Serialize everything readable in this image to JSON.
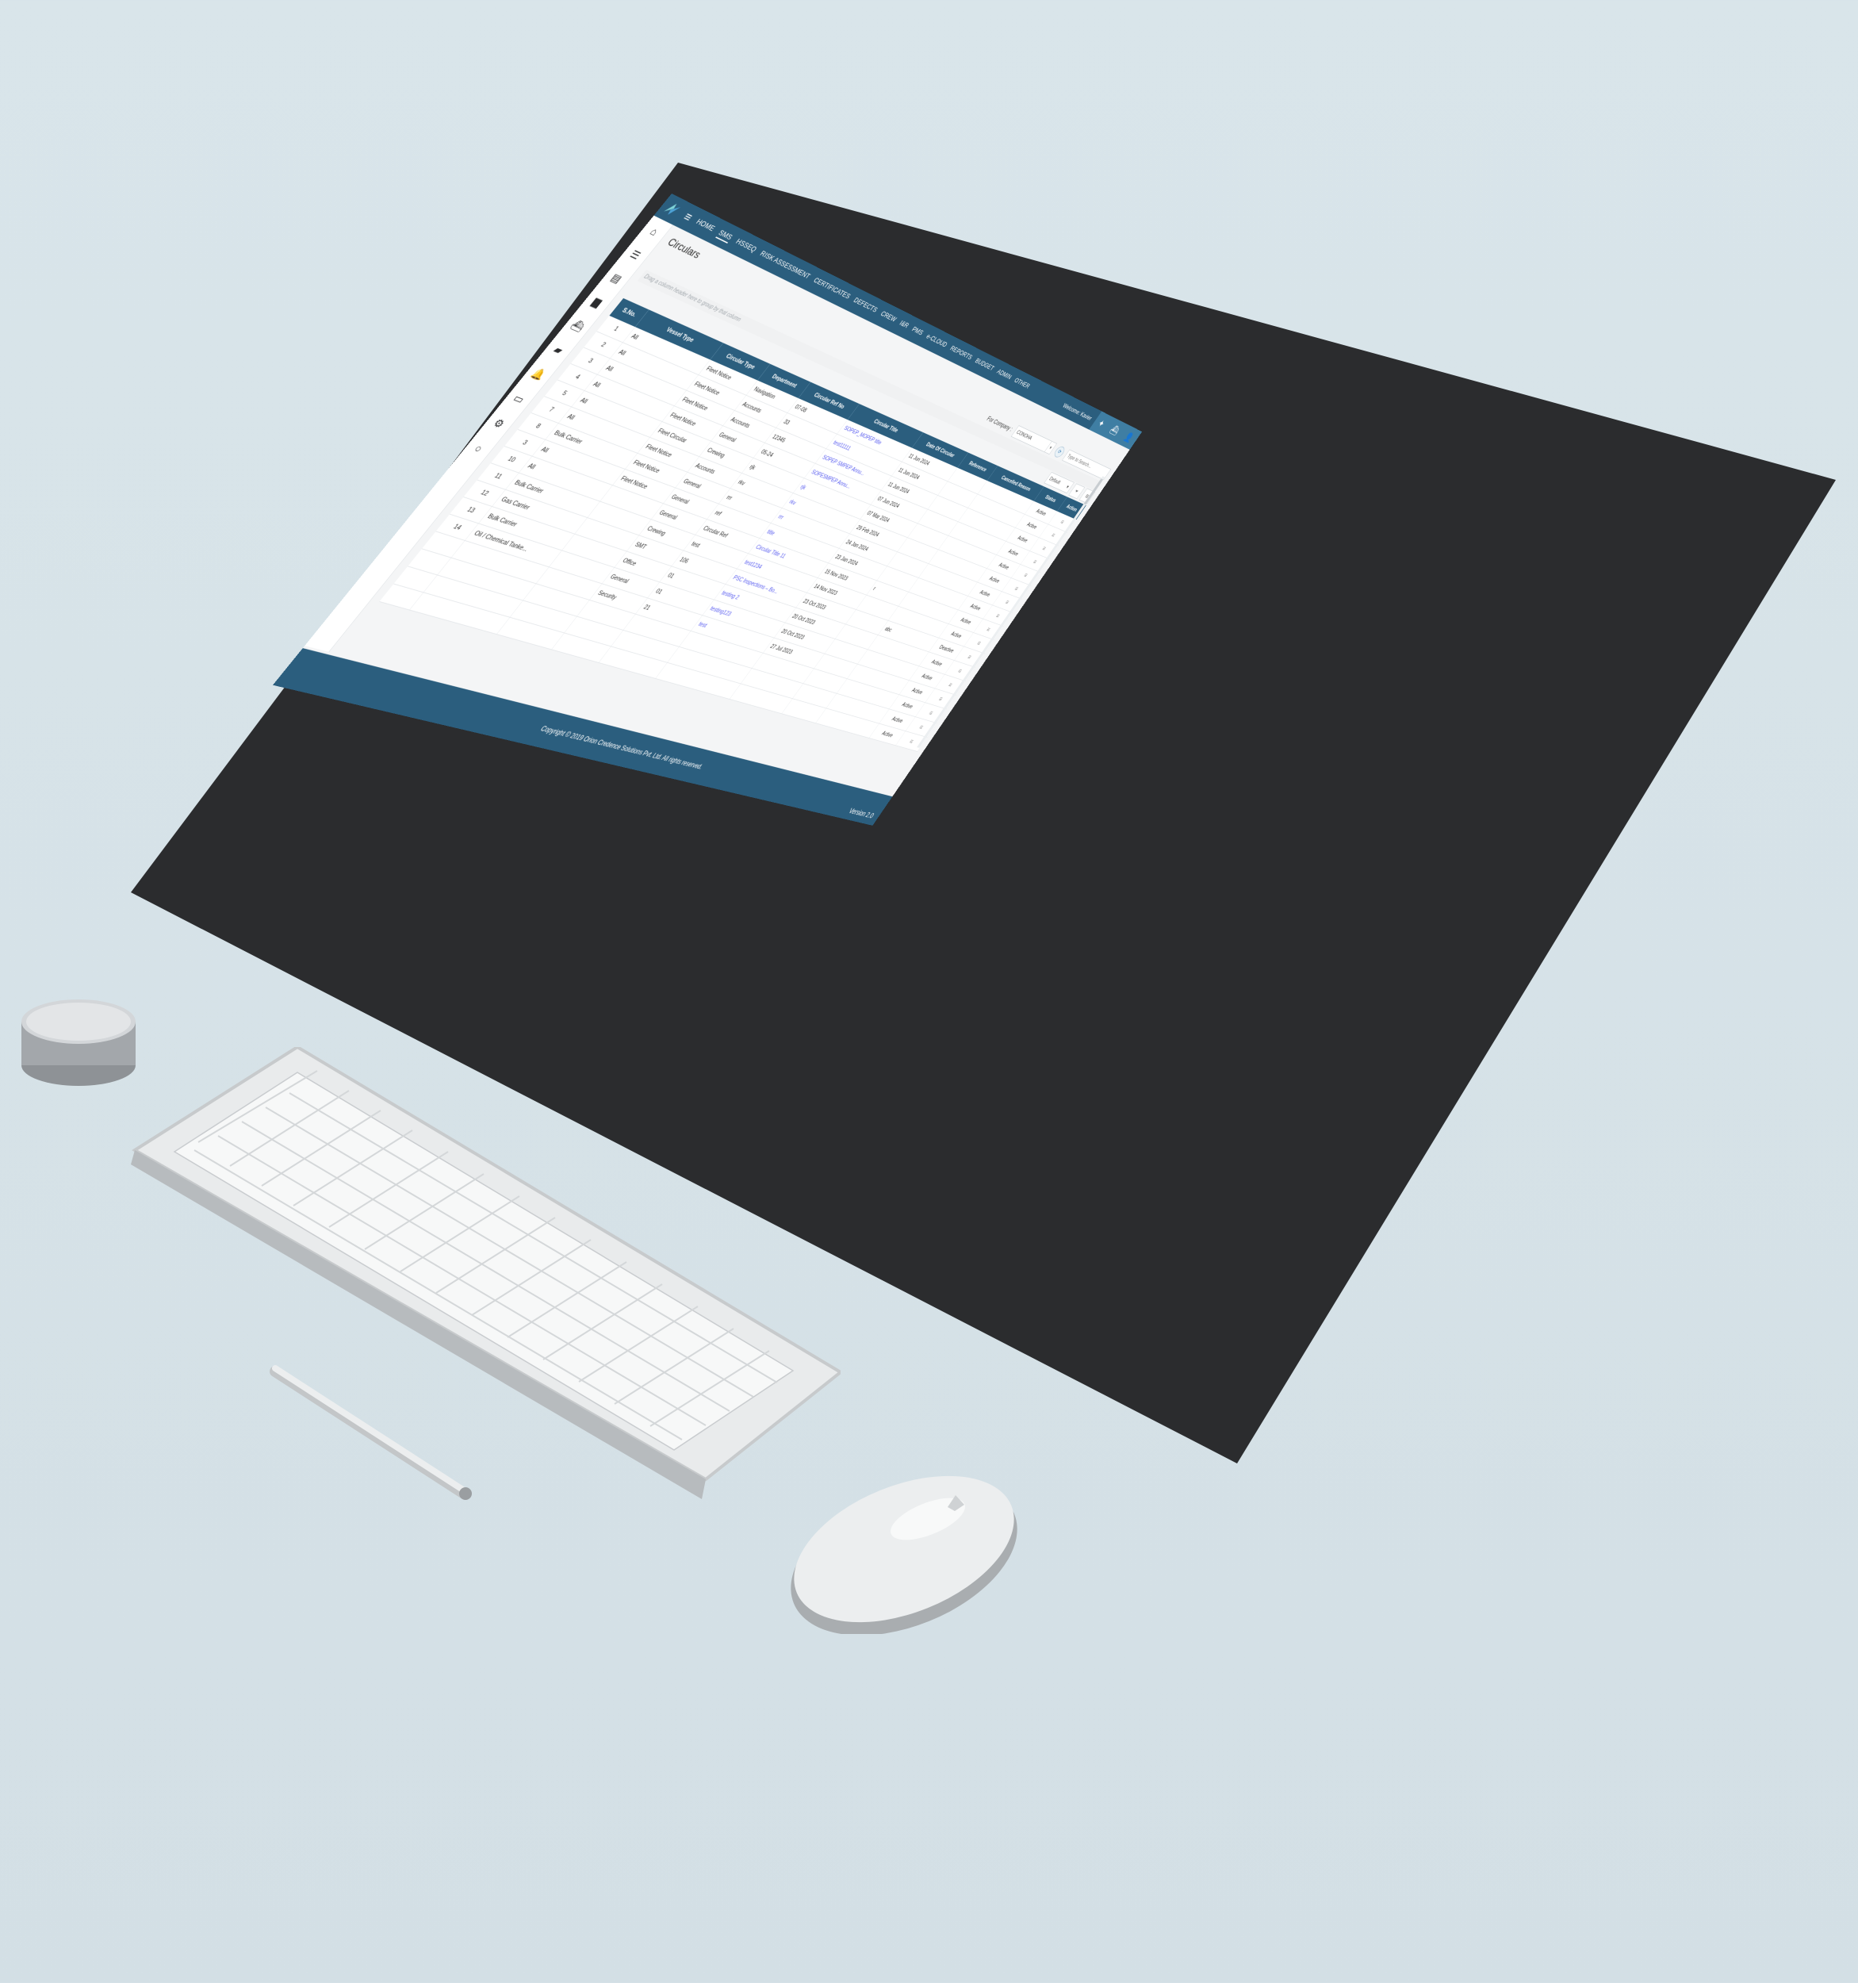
{
  "app": {
    "menu_icon": "hamburger-icon",
    "nav": [
      "HOME",
      "SMS",
      "HSSEQ",
      "RISK ASSESSMENT",
      "CERTIFICATES",
      "DEFECTS",
      "CREW",
      "I&R",
      "PMS",
      "e-CLOUD",
      "REPORTS",
      "BUDGET",
      "ADMIN",
      "OTHER"
    ],
    "active_nav": "SMS",
    "welcome": "Welcome: Kavier",
    "top_icons": [
      "logo-icon",
      "ship-icon",
      "user-icon"
    ]
  },
  "sidebar": [
    "home-icon",
    "list-icon",
    "document-icon",
    "folder-icon",
    "ship-icon",
    "folder-open-icon",
    "bell-icon",
    "file-icon",
    "settings-icon",
    "circle-icon"
  ],
  "page": {
    "title": "Circulars",
    "company_label": "For Company :",
    "company_value": "CONOHA",
    "search_placeholder": "Type to Search...",
    "group_hint": "Drag a column header here to group by that column",
    "view_select": "Default",
    "filter_icon": "filter-icon",
    "columns_icon": "columns-icon"
  },
  "table": {
    "columns": [
      "S.No.",
      "Vessel Type",
      "Circular Type",
      "Department",
      "Circular Ref No",
      "Circular Title",
      "Date Of Circular",
      "Reference",
      "Cancelled Reason",
      "Status",
      "Action"
    ],
    "rows": [
      [
        "1",
        "All",
        "Fleet Notice",
        "Navigation",
        "07-08",
        "SOPEP_MOPEP title",
        "11 Jun 2024",
        "",
        "",
        "Active"
      ],
      [
        "2",
        "All",
        "Fleet Notice",
        "Accounts",
        "33",
        "test11111",
        "11 Jun 2024",
        "",
        "",
        "Active"
      ],
      [
        "3",
        "All",
        "Fleet Notice",
        "Accounts",
        "12345",
        "SOPEP SMPEP Annu...",
        "11 Jun 2024",
        "",
        "",
        "Active"
      ],
      [
        "4",
        "All",
        "Fleet Notice",
        "General",
        "05-24",
        "SOPESMPEP Annu...",
        "07 Jun 2024",
        "",
        "",
        "Active"
      ],
      [
        "5",
        "All",
        "Fleet Circular",
        "Crewing",
        "rjk",
        "rjk",
        "07 Mar 2024",
        "",
        "",
        "Active"
      ],
      [
        "7",
        "All",
        "Fleet Notice",
        "Accounts",
        "rkv",
        "rkv",
        "29 Feb 2024",
        "",
        "",
        "Active"
      ],
      [
        "8",
        "Bulk Carrier",
        "Fleet Notice",
        "General",
        "rrr",
        "rrr",
        "24 Jan 2024",
        "",
        "",
        "Active"
      ],
      [
        "3",
        "All",
        "Fleet Notice",
        "General",
        "ref",
        "title",
        "23 Jan 2024",
        "",
        "",
        "Active"
      ],
      [
        "10",
        "All",
        "",
        "General",
        "Circular Ref",
        "Circular Title 11",
        "15 Nov 2023",
        "r",
        "",
        "Active"
      ],
      [
        "11",
        "Bulk Carrier",
        "",
        "Crewing",
        "test",
        "test1234",
        "14 Nov 2023",
        "",
        "",
        "Active"
      ],
      [
        "12",
        "Gas Carrier",
        "",
        "SMT",
        "106",
        "PSC Inspections – Bo...",
        "23 Oct 2023",
        "",
        "abc",
        "Deactive"
      ],
      [
        "13",
        "Bulk Carrier",
        "",
        "Office",
        "01",
        "testing 2",
        "20 Oct 2023",
        "",
        "",
        "Active"
      ],
      [
        "14",
        "Oil / Chemical Tanke...",
        "",
        "General",
        "01",
        "testing123",
        "20 Oct 2023",
        "",
        "",
        "Active"
      ],
      [
        "",
        "",
        "",
        "Security",
        "21",
        "test",
        "27 Jul 2023",
        "",
        "",
        "Active"
      ],
      [
        "",
        "",
        "",
        "",
        "",
        "",
        "",
        "",
        "",
        "Active"
      ],
      [
        "",
        "",
        "",
        "",
        "",
        "",
        "",
        "",
        "",
        "Active"
      ],
      [
        "",
        "",
        "",
        "",
        "",
        "",
        "",
        "",
        "",
        "Active"
      ]
    ],
    "action_icon": "menu-lines-icon"
  },
  "footer": {
    "copyright": "Copyright © 2019 Orion Credence Solutions Pvt. Ltd. All rights reserved.",
    "version": "Version 2.0"
  },
  "colors": {
    "header": "#2b5e7e",
    "accent": "#3f7ea3",
    "link": "#5a5ef0",
    "background": "#d9e5ea"
  }
}
